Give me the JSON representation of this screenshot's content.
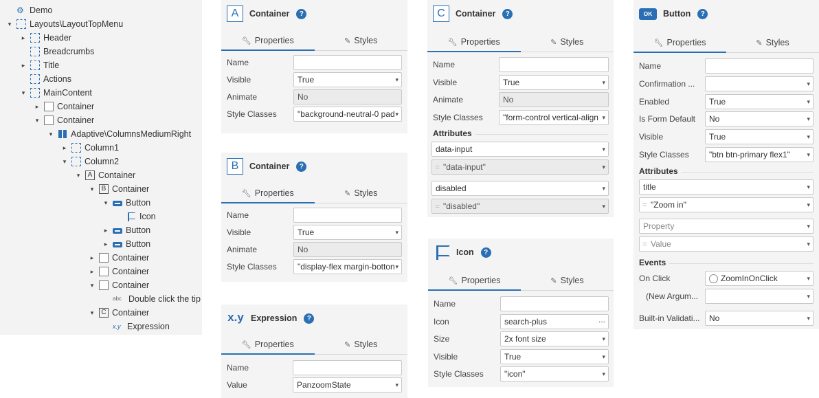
{
  "tree": [
    {
      "label": "Demo",
      "icon": "gear-icon",
      "indent": 0,
      "toggle": ""
    },
    {
      "label": "Layouts\\LayoutTopMenu",
      "icon": "layout-icon",
      "indent": 0,
      "toggle": "▾"
    },
    {
      "label": "Header",
      "icon": "placeholder-icon",
      "indent": 1,
      "toggle": "▸"
    },
    {
      "label": "Breadcrumbs",
      "icon": "placeholder-icon",
      "indent": 1,
      "toggle": ""
    },
    {
      "label": "Title",
      "icon": "placeholder-icon",
      "indent": 1,
      "toggle": "▸"
    },
    {
      "label": "Actions",
      "icon": "placeholder-icon",
      "indent": 1,
      "toggle": ""
    },
    {
      "label": "MainContent",
      "icon": "placeholder-icon",
      "indent": 1,
      "toggle": "▾"
    },
    {
      "label": "Container",
      "icon": "container-icon",
      "indent": 2,
      "toggle": "▸"
    },
    {
      "label": "Container",
      "icon": "container-icon",
      "indent": 2,
      "toggle": "▾"
    },
    {
      "label": "Adaptive\\ColumnsMediumRight",
      "icon": "columns-icon",
      "indent": 3,
      "toggle": "▾"
    },
    {
      "label": "Column1",
      "icon": "placeholder-icon",
      "indent": 4,
      "toggle": "▸"
    },
    {
      "label": "Column2",
      "icon": "placeholder-icon",
      "indent": 4,
      "toggle": "▾"
    },
    {
      "label": "Container",
      "icon": "container-a-icon",
      "indent": 5,
      "toggle": "▾",
      "letter": "A"
    },
    {
      "label": "Container",
      "icon": "container-b-icon",
      "indent": 6,
      "toggle": "▾",
      "letter": "B"
    },
    {
      "label": "Button",
      "icon": "button-icon",
      "indent": 7,
      "toggle": "▾"
    },
    {
      "label": "Icon",
      "icon": "flag-icon",
      "indent": 8,
      "toggle": ""
    },
    {
      "label": "Button",
      "icon": "button-icon",
      "indent": 7,
      "toggle": "▸"
    },
    {
      "label": "Button",
      "icon": "button-icon",
      "indent": 7,
      "toggle": "▸"
    },
    {
      "label": "Container",
      "icon": "container-icon",
      "indent": 6,
      "toggle": "▸"
    },
    {
      "label": "Container",
      "icon": "container-icon",
      "indent": 6,
      "toggle": "▸"
    },
    {
      "label": "Container",
      "icon": "container-icon",
      "indent": 6,
      "toggle": "▾"
    },
    {
      "label": "Double click the tip",
      "icon": "text-icon",
      "indent": 7,
      "toggle": "",
      "glyph": "abc"
    },
    {
      "label": "Container",
      "icon": "container-c-icon",
      "indent": 6,
      "toggle": "▾",
      "letter": "C"
    },
    {
      "label": "Expression",
      "icon": "expression-icon",
      "indent": 7,
      "toggle": "",
      "glyph": "x.y"
    }
  ],
  "tabs": {
    "properties": "Properties",
    "styles": "Styles"
  },
  "help_glyph": "?",
  "panelA": {
    "badge": "A",
    "title": "Container",
    "rows": [
      {
        "label": "Name",
        "value": "",
        "kind": "text"
      },
      {
        "label": "Visible",
        "value": "True",
        "kind": "select"
      },
      {
        "label": "Animate",
        "value": "No",
        "kind": "disabled"
      },
      {
        "label": "Style Classes",
        "value": "\"background-neutral-0 pad",
        "kind": "select"
      }
    ]
  },
  "panelB": {
    "badge": "B",
    "title": "Container",
    "rows": [
      {
        "label": "Name",
        "value": "",
        "kind": "text"
      },
      {
        "label": "Visible",
        "value": "True",
        "kind": "select"
      },
      {
        "label": "Animate",
        "value": "No",
        "kind": "disabled"
      },
      {
        "label": "Style Classes",
        "value": "\"display-flex margin-botton",
        "kind": "select"
      }
    ]
  },
  "panelExpr": {
    "badge": "x.y",
    "title": "Expression",
    "rows": [
      {
        "label": "Name",
        "value": "",
        "kind": "text"
      },
      {
        "label": "Value",
        "value": "PanzoomState",
        "kind": "select"
      }
    ]
  },
  "panelC": {
    "badge": "C",
    "title": "Container",
    "rows": [
      {
        "label": "Name",
        "value": "",
        "kind": "text"
      },
      {
        "label": "Visible",
        "value": "True",
        "kind": "select"
      },
      {
        "label": "Animate",
        "value": "No",
        "kind": "disabled"
      },
      {
        "label": "Style Classes",
        "value": "\"form-control vertical-align",
        "kind": "select"
      }
    ],
    "attributes_label": "Attributes",
    "attributes": [
      {
        "name": "data-input",
        "value": "\"data-input\""
      },
      {
        "name": "disabled",
        "value": "\"disabled\""
      }
    ]
  },
  "panelIcon": {
    "title": "Icon",
    "rows": [
      {
        "label": "Name",
        "value": "",
        "kind": "text"
      },
      {
        "label": "Icon",
        "value": "search-plus",
        "kind": "dots"
      },
      {
        "label": "Size",
        "value": "2x font size",
        "kind": "select"
      },
      {
        "label": "Visible",
        "value": "True",
        "kind": "select"
      },
      {
        "label": "Style Classes",
        "value": "\"icon\"",
        "kind": "select"
      }
    ]
  },
  "panelButton": {
    "badge": "OK",
    "title": "Button",
    "rows": [
      {
        "label": "Name",
        "value": "",
        "kind": "text"
      },
      {
        "label": "Confirmation ...",
        "value": "",
        "kind": "select"
      },
      {
        "label": "Enabled",
        "value": "True",
        "kind": "select"
      },
      {
        "label": "Is Form Default",
        "value": "No",
        "kind": "select"
      },
      {
        "label": "Visible",
        "value": "True",
        "kind": "select"
      },
      {
        "label": "Style Classes",
        "value": "\"btn btn-primary flex1\"",
        "kind": "select"
      }
    ],
    "attributes_label": "Attributes",
    "attributes": [
      {
        "name": "title",
        "value": "\"Zoom in\"",
        "name_placeholder": false,
        "value_placeholder": false
      },
      {
        "name": "Property",
        "value": "Value",
        "name_placeholder": true,
        "value_placeholder": true
      }
    ],
    "events_label": "Events",
    "events": [
      {
        "label": "On Click",
        "value": "ZoomInOnClick",
        "kind": "radio"
      },
      {
        "label": "(New Argum...",
        "value": "",
        "kind": "select"
      },
      {
        "label": "Built-in Validati...",
        "value": "No",
        "kind": "select"
      }
    ]
  }
}
